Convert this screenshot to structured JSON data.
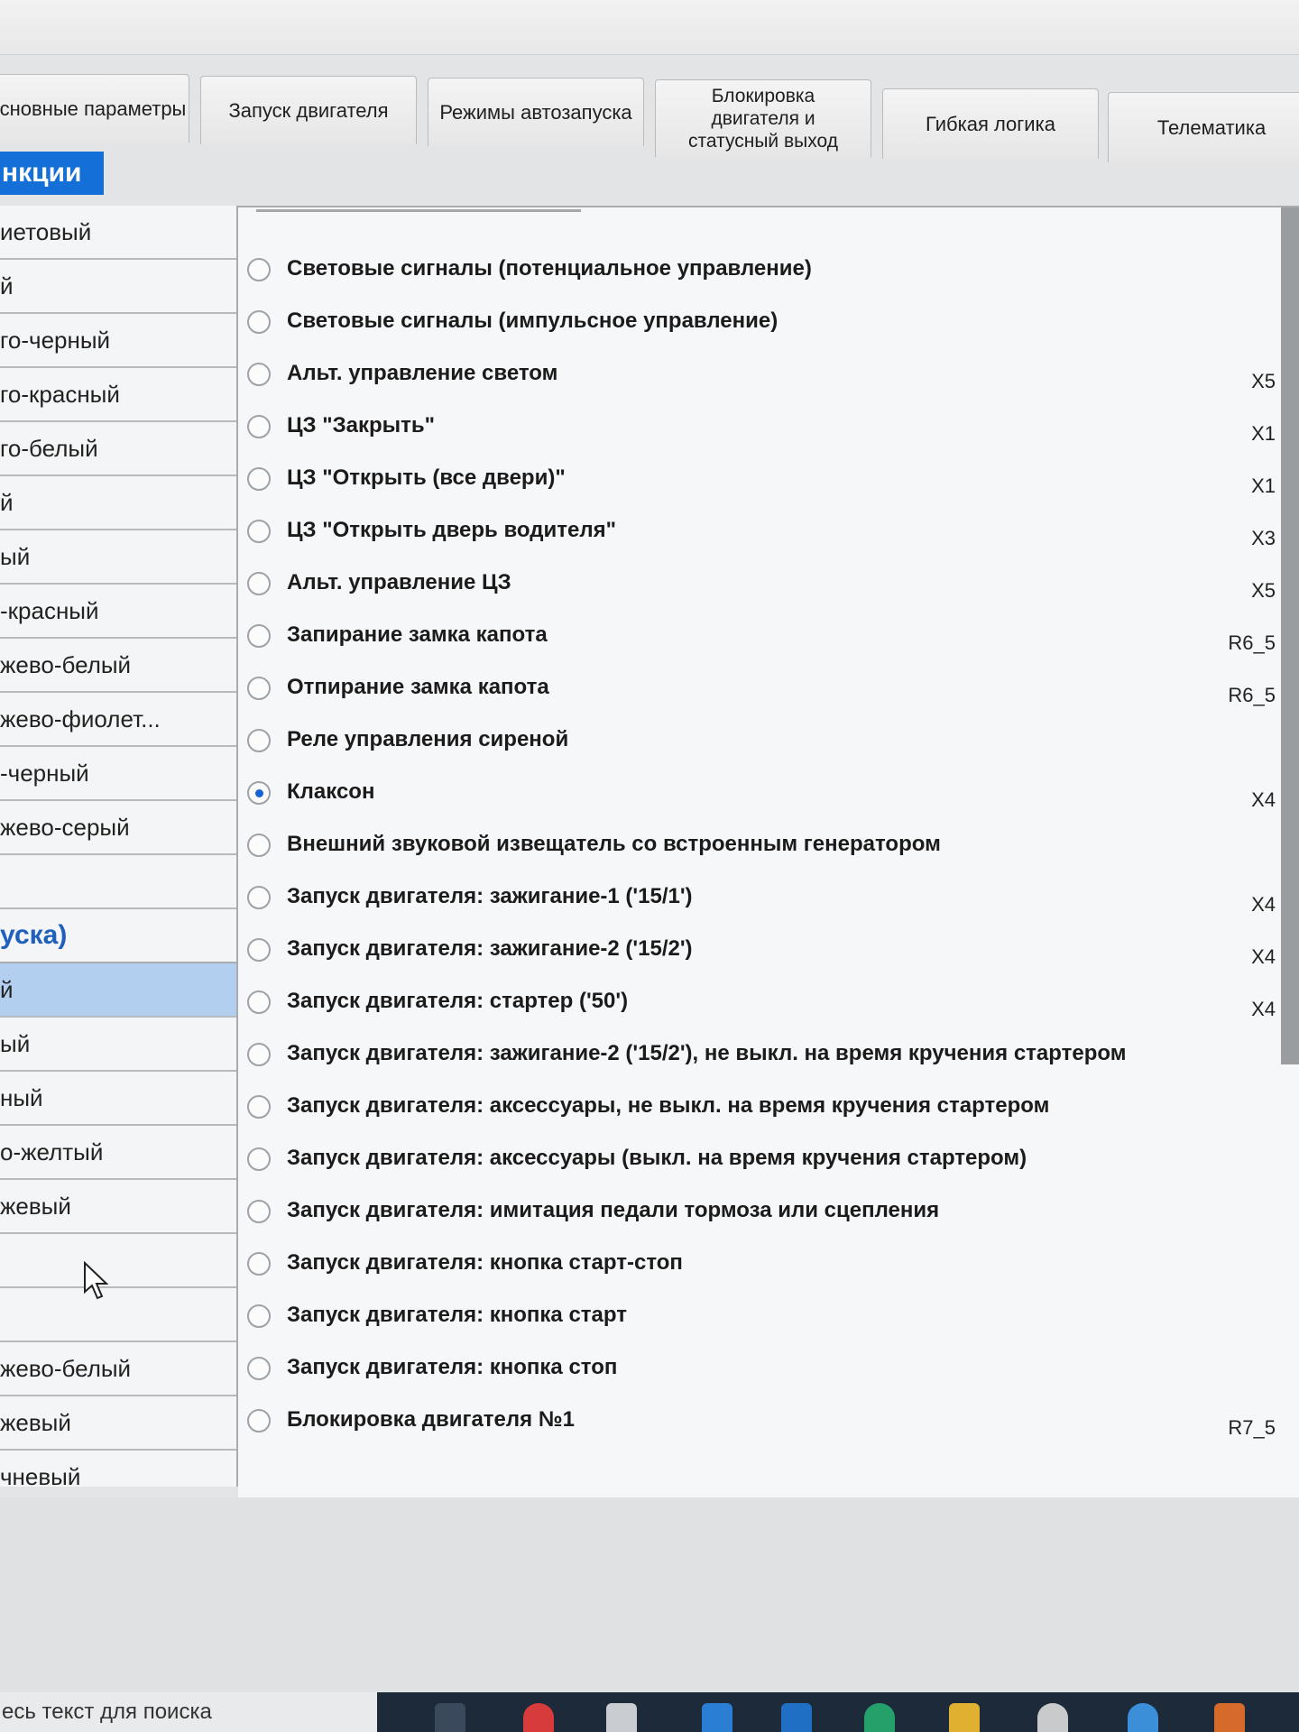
{
  "tabs": [
    {
      "label": "сновные параметры"
    },
    {
      "label": "Запуск двигателя"
    },
    {
      "label": "Режимы автозапуска"
    },
    {
      "label_lines": [
        "Блокировка",
        "двигателя и",
        "статусный выход"
      ]
    },
    {
      "label": "Гибкая логика"
    },
    {
      "label": "Телематика"
    }
  ],
  "section_button": "нкции",
  "wires": [
    {
      "label": "иетовый"
    },
    {
      "label": "й"
    },
    {
      "label": "го-черный"
    },
    {
      "label": "го-красный"
    },
    {
      "label": "го-белый"
    },
    {
      "label": "й"
    },
    {
      "label": "ый"
    },
    {
      "label": "-красный"
    },
    {
      "label": "жево-белый"
    },
    {
      "label": "жево-фиолет..."
    },
    {
      "label": "-черный"
    },
    {
      "label": "жево-серый"
    },
    {
      "label": ""
    },
    {
      "label": "уска)"
    },
    {
      "label": "й"
    },
    {
      "label": "ый"
    },
    {
      "label": "ный"
    },
    {
      "label": "о-желтый"
    },
    {
      "label": "жевый"
    },
    {
      "label": ""
    },
    {
      "label": ""
    },
    {
      "label": "жево-белый"
    },
    {
      "label": "жевый"
    },
    {
      "label": "чневый"
    }
  ],
  "options": [
    {
      "label": "Световые сигналы (потенциальное управление)",
      "output": "",
      "selected": false
    },
    {
      "label": "Световые сигналы (импульсное управление)",
      "output": "",
      "selected": false
    },
    {
      "label": "Альт. управление светом",
      "output": "X5",
      "selected": false
    },
    {
      "label": "ЦЗ \"Закрыть\"",
      "output": "X1",
      "selected": false
    },
    {
      "label": "ЦЗ \"Открыть (все двери)\"",
      "output": "X1",
      "selected": false
    },
    {
      "label": "ЦЗ \"Открыть дверь водителя\"",
      "output": "X3",
      "selected": false
    },
    {
      "label": "Альт. управление ЦЗ",
      "output": "X5",
      "selected": false
    },
    {
      "label": "Запирание замка капота",
      "output": "R6_5",
      "selected": false
    },
    {
      "label": "Отпирание замка капота",
      "output": "R6_5",
      "selected": false
    },
    {
      "label": "Реле управления сиреной",
      "output": "",
      "selected": false
    },
    {
      "label": "Клаксон",
      "output": "X4",
      "selected": true
    },
    {
      "label": "Внешний звуковой извещатель со встроенным генератором",
      "output": "",
      "selected": false
    },
    {
      "label": "Запуск двигателя: зажигание-1 ('15/1')",
      "output": "X4",
      "selected": false
    },
    {
      "label": "Запуск двигателя: зажигание-2 ('15/2')",
      "output": "X4",
      "selected": false
    },
    {
      "label": "Запуск двигателя: стартер ('50')",
      "output": "X4",
      "selected": false
    },
    {
      "label": "Запуск двигателя: зажигание-2 ('15/2'), не выкл. на время кручения стартером",
      "output": "",
      "selected": false
    },
    {
      "label": "Запуск двигателя: аксессуары, не выкл. на время кручения стартером",
      "output": "",
      "selected": false
    },
    {
      "label": "Запуск двигателя: аксессуары (выкл. на время кручения стартером)",
      "output": "",
      "selected": false
    },
    {
      "label": "Запуск двигателя: имитация педали тормоза или сцепления",
      "output": "",
      "selected": false
    },
    {
      "label": "Запуск двигателя: кнопка старт-стоп",
      "output": "",
      "selected": false
    },
    {
      "label": "Запуск двигателя: кнопка старт",
      "output": "",
      "selected": false
    },
    {
      "label": "Запуск двигателя: кнопка стоп",
      "output": "",
      "selected": false
    },
    {
      "label": "Блокировка двигателя №1",
      "output": "R7_5",
      "selected": false
    }
  ],
  "search_placeholder": "есь текст для поиска",
  "colors": {
    "accent": "#1470d6",
    "selected_row": "#b3cff0",
    "radio_dot": "#1664d3"
  }
}
